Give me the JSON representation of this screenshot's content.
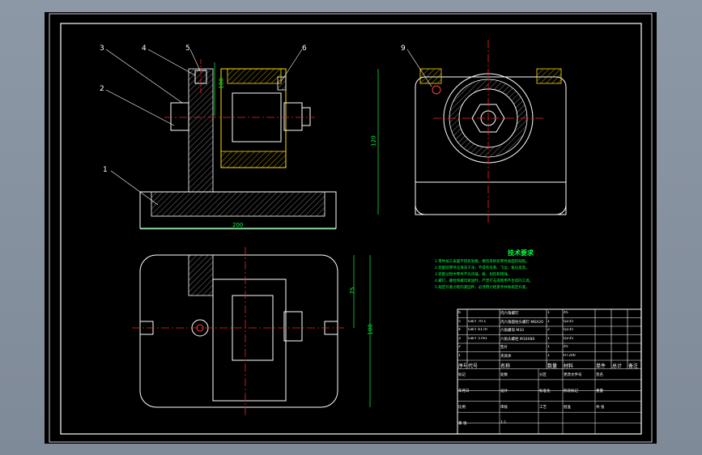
{
  "callouts": [
    "1",
    "2",
    "3",
    "4",
    "5",
    "6",
    "9"
  ],
  "dimensions": {
    "front_width": "200",
    "front_height": "100",
    "side_height": "120",
    "plan_depth": "75",
    "plan_width": "100"
  },
  "tech_requirements": {
    "title": "技术要求",
    "lines": [
      "1.零件加工表面不得有划痕、擦伤等损伤零件表面的缺陷。",
      "2.装配前零件应清洗干净，不得有毛刺、飞边、氧化皮等。",
      "3.装配过程中零件不允许磕、碰、划伤和锈蚀。",
      "4.螺钉、螺栓和螺母紧固时，严禁打击或使用不合适的工具。",
      "5.规定拧紧力矩的紧固件，必须用力矩扳手并按规定拧紧。"
    ]
  },
  "bom": {
    "rows": [
      [
        "6",
        "",
        "内六角螺钉",
        "1",
        "45",
        "",
        "",
        ""
      ],
      [
        "5",
        "GB/T 70.1",
        "内六角圆柱头螺钉 M6X20",
        "1",
        "Q235",
        "",
        "",
        ""
      ],
      [
        "4",
        "GB/T 6170",
        "六角螺母 M10",
        "2",
        "Q235",
        "",
        "",
        ""
      ],
      [
        "3",
        "GB/T 5781",
        "六角头螺栓 M10X80",
        "1",
        "Q235",
        "",
        "",
        ""
      ],
      [
        "2",
        "",
        "垫片",
        "1",
        "45",
        "",
        "",
        ""
      ],
      [
        "1",
        "",
        "夹具体",
        "1",
        "HT200",
        "",
        "",
        ""
      ]
    ],
    "header": [
      "序号",
      "代号",
      "名称",
      "数量",
      "材料",
      "单件",
      "总计",
      "备注"
    ]
  },
  "title_block": {
    "cells": [
      "标记",
      "处数",
      "分区",
      "更改文件号",
      "签名",
      "年月日",
      "设计",
      "标准化",
      "阶段标记",
      "重量",
      "比例",
      "审核",
      "工艺",
      "批准",
      "共 张",
      "第 张",
      "1:1"
    ]
  }
}
